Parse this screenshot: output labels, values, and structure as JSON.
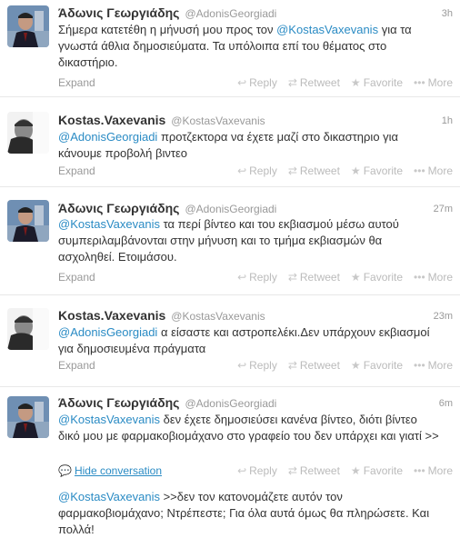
{
  "actions": {
    "reply": "Reply",
    "retweet": "Retweet",
    "favorite": "Favorite",
    "more": "More",
    "expand": "Expand",
    "hide": "Hide conversation"
  },
  "icons": {
    "reply": "reply-icon",
    "retweet": "retweet-icon",
    "favorite": "star-icon",
    "more": "ellipsis-icon",
    "hide": "speech-bubble-icon"
  },
  "colors": {
    "link": "#2a8bc4",
    "muted": "#999999"
  },
  "tweets": [
    {
      "name": "Άδωνις Γεωργιάδης",
      "handle": "@AdonisGeorgiadi",
      "time": "3h",
      "text_before": "Σήμερα κατετέθη η μήνυσή μου προς τον ",
      "mention": "@KostasVaxevanis",
      "text_after": " για τα γνωστά άθλια δημοσιεύματα. Τα υπόλοιπα επί του θέματος στο δικαστήριο."
    },
    {
      "name": "Kostas.Vaxevanis",
      "handle": "@KostasVaxevanis",
      "time": "1h",
      "mention": "@AdonisGeorgiadi",
      "text_after": " προτζεκτορα να έχετε μαζί στο δικαστηριο για κάνουμε προβολή βιντεο"
    },
    {
      "name": "Άδωνις Γεωργιάδης",
      "handle": "@AdonisGeorgiadi",
      "time": "27m",
      "mention": "@KostasVaxevanis",
      "text_after": " τα περί βίντεο και του εκβιασμού μέσω αυτού συμπεριλαμβάνονται στην μήνυση και το τμήμα εκβιασμών θα ασχοληθεί. Ετοιμάσου."
    },
    {
      "name": "Kostas.Vaxevanis",
      "handle": "@KostasVaxevanis",
      "time": "23m",
      "mention": "@AdonisGeorgiadi",
      "text_after": " α είσαστε και αστροπελέκι.Δεν υπάρχουν εκβιασμοί για δημοσιευμένα πράγματα"
    },
    {
      "name": "Άδωνις Γεωργιάδης",
      "handle": "@AdonisGeorgiadi",
      "time": "6m",
      "mention": "@KostasVaxevanis",
      "text_after": " δεν έχετε δημοσιεύσει κανένα βίντεο, διότι βίντεο δικό μου με φαρμακοβιομάχανο στο γραφείο του δεν υπάρχει και γιατί >>"
    }
  ],
  "reply": {
    "mention": "@KostasVaxevanis",
    "text_after": " >>δεν τον κατονομάζετε αυτόν τον φαρμακοβιομάχανο; Ντρέπεστε; Για όλα αυτά όμως θα πληρώσετε. Και πολλά!"
  }
}
